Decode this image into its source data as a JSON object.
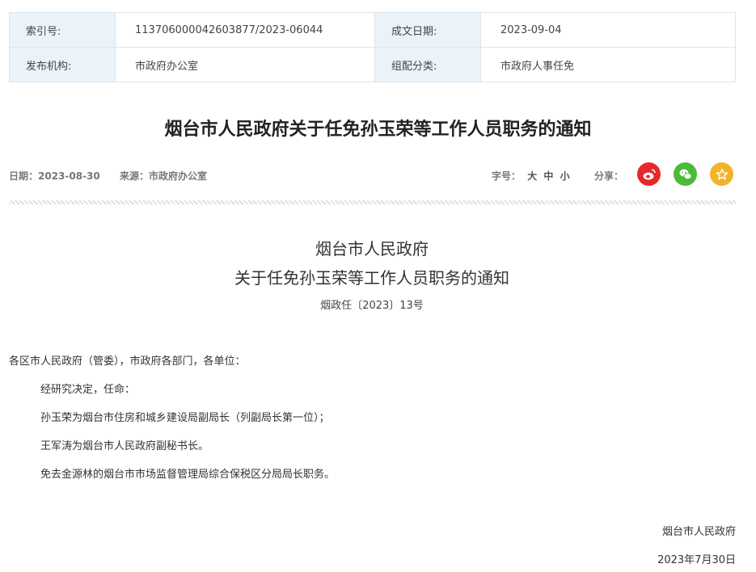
{
  "meta": {
    "index_label": "索引号:",
    "index_value": "113706000042603877/2023-06044",
    "date_label": "成文日期:",
    "date_value": "2023-09-04",
    "publisher_label": "发布机构:",
    "publisher_value": "市政府办公室",
    "category_label": "组配分类:",
    "category_value": "市政府人事任免"
  },
  "title": "烟台市人民政府关于任免孙玉荣等工作人员职务的通知",
  "info": {
    "date": "日期：2023-08-30",
    "source": "来源：市政府办公室",
    "font_size_label": "字号：",
    "font_large": "大",
    "font_medium": "中",
    "font_small": "小",
    "share_label": "分享："
  },
  "doc": {
    "title_line1": "烟台市人民政府",
    "title_line2": "关于任免孙玉荣等工作人员职务的通知",
    "doc_number": "烟政任〔2023〕13号",
    "salutation": "各区市人民政府（管委），市政府各部门，各单位：",
    "paragraphs": [
      "经研究决定，任命：",
      "孙玉荣为烟台市住房和城乡建设局副局长（列副局长第一位）；",
      "王军涛为烟台市人民政府副秘书长。",
      "免去金源林的烟台市市场监督管理局综合保税区分局局长职务。"
    ],
    "signature": "烟台市人民政府",
    "sign_date": "2023年7月30日"
  },
  "colors": {
    "weibo": "#e6282b",
    "wechat": "#4cb93a",
    "favorite": "#f2b32b",
    "meta_label_bg": "#eaf3f9"
  },
  "icons": [
    "weibo-icon",
    "wechat-icon",
    "star-icon"
  ]
}
